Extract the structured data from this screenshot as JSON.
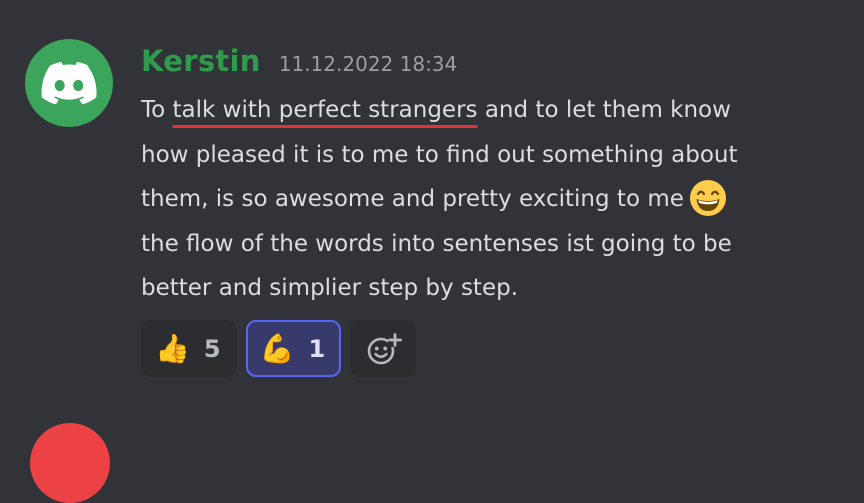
{
  "message": {
    "author": "Kerstin",
    "timestamp": "11.12.2022 18:34",
    "lines": {
      "l1_pre": "To ",
      "l1_underlined": "talk with perfect strangers",
      "l1_post": " and to let them know",
      "l2": "how pleased it is to me  to find out something about",
      "l3": "them, is so awesome and pretty exciting to me",
      "l4": "the flow of the words into sentenses ist going to be",
      "l5": "better and simplier  step by step."
    },
    "inline_emoji": "grinning-face-with-smiling-eyes"
  },
  "reactions": [
    {
      "emoji": "👍",
      "icon": "thumbs-up-icon",
      "count": "5",
      "active": false
    },
    {
      "emoji": "💪",
      "icon": "flexed-biceps-icon",
      "count": "1",
      "active": true
    }
  ],
  "add_reaction_icon": "add-reaction-icon",
  "colors": {
    "background": "#313338",
    "username": "#2e9c4c",
    "avatar": "#3ba55c",
    "underline": "#e0313c",
    "active_reaction_border": "#5865f2"
  }
}
